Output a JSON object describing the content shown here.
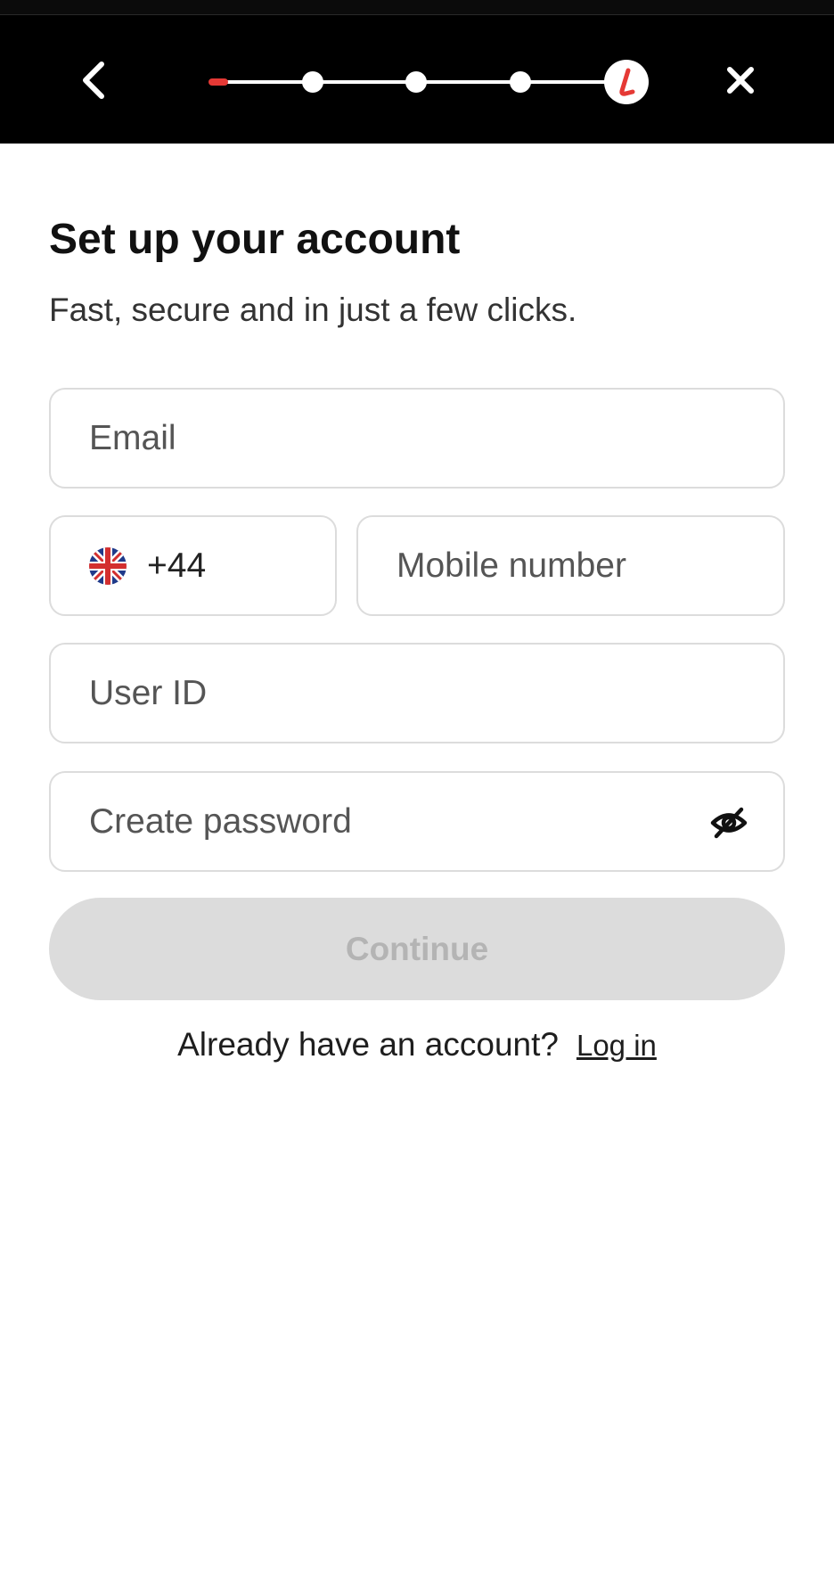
{
  "header": {
    "back_icon": "chevron-left-icon",
    "close_icon": "close-icon",
    "brand_mark": "L",
    "progress": {
      "steps": 5,
      "current": 1,
      "accent_color": "#e53935"
    }
  },
  "main": {
    "title": "Set up your account",
    "subtitle": "Fast, secure and in just a few clicks."
  },
  "form": {
    "email": {
      "placeholder": "Email"
    },
    "country": {
      "flag_icon": "uk-flag-icon",
      "code": "+44"
    },
    "mobile": {
      "placeholder": "Mobile number"
    },
    "user_id": {
      "placeholder": "User ID"
    },
    "password": {
      "placeholder": "Create password",
      "toggle_icon": "eye-off-icon"
    },
    "continue_label": "Continue",
    "continue_enabled": false
  },
  "footer": {
    "question": "Already have an account?",
    "login_label": "Log in"
  }
}
